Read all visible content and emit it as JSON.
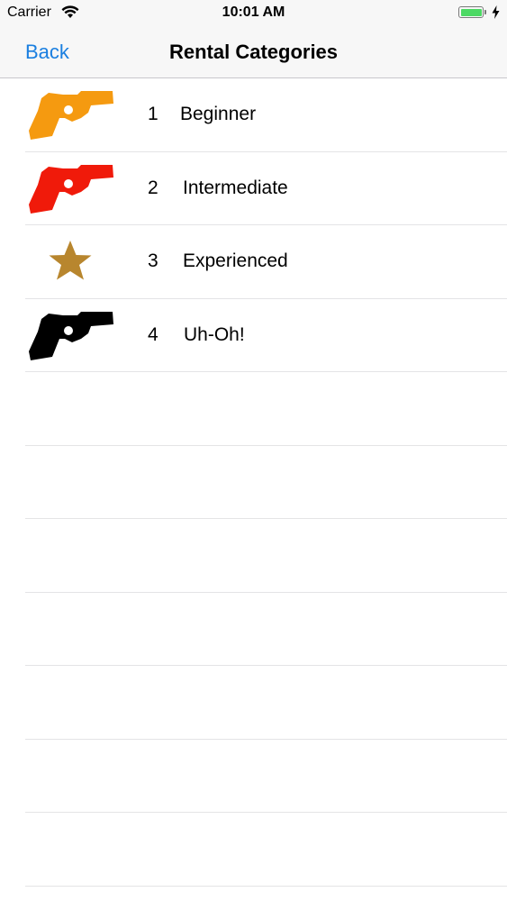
{
  "status_bar": {
    "carrier": "Carrier",
    "time": "10:01 AM",
    "battery_level": 1.0,
    "battery_color": "#4cd964"
  },
  "nav_bar": {
    "back_label": "Back",
    "title": "Rental Categories",
    "accent_color": "#1a7fe0"
  },
  "categories": [
    {
      "number": "1",
      "label": "Beginner",
      "icon": "revolver-icon",
      "color": "#f59a10"
    },
    {
      "number": "2",
      "label": "Intermediate",
      "icon": "revolver-icon",
      "color": "#f01a0a"
    },
    {
      "number": "3",
      "label": "Experienced",
      "icon": "star-icon",
      "color": "#b8862e"
    },
    {
      "number": "4",
      "label": "Uh-Oh!",
      "icon": "revolver-icon",
      "color": "#000000"
    }
  ]
}
